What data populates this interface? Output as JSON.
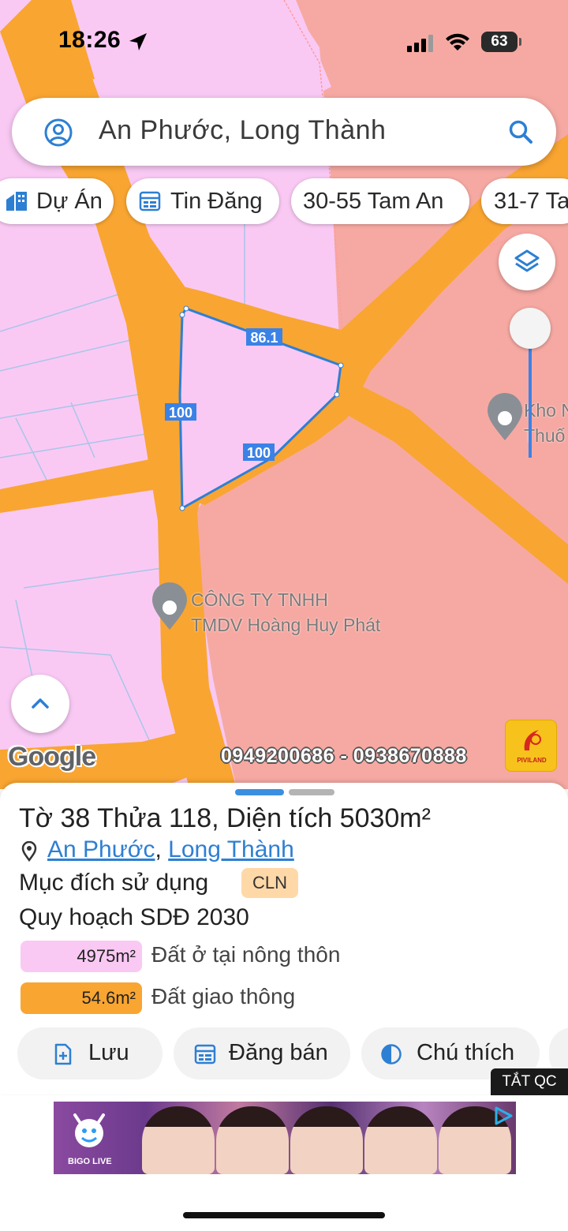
{
  "status_bar": {
    "time": "18:26",
    "battery": "63"
  },
  "search": {
    "query": "An Phước, Long Thành"
  },
  "chips": [
    {
      "label": "Dự Án",
      "icon": "building-icon"
    },
    {
      "label": "Tin Đăng",
      "icon": "listing-icon"
    },
    {
      "label": "30-55 Tam An",
      "icon": ""
    },
    {
      "label": "31-7 Ta",
      "icon": ""
    }
  ],
  "map": {
    "edge_labels": [
      "86.1",
      "100",
      "100"
    ],
    "poi_1": {
      "line1": "CÔNG TY TNHH",
      "line2": "TMDV Hoàng Huy Phát"
    },
    "poi_2": {
      "line1": "Kho N",
      "line2": "Thuố"
    },
    "google_logo": "Google",
    "phone_overlay": "0949200686 - 0938670888",
    "brand_badge": "PIVILAND",
    "colors": {
      "residential": "#f9c9f4",
      "rural": "#f6a9a2",
      "road": "#f9a531",
      "parcel_border": "#2f7fd4"
    }
  },
  "parcel": {
    "title": "Tờ 38 Thửa 118, Diện tích 5030m²",
    "location": {
      "commune": "An Phước",
      "separator": ",",
      "district": "Long Thành"
    },
    "purpose_label": "Mục đích sử dụng",
    "purpose_code": "CLN",
    "plan_label": "Quy hoạch SDĐ 2030",
    "zones": [
      {
        "area": "4975m²",
        "label": "Đất ở tại nông thôn",
        "color": "#f9c9f4"
      },
      {
        "area": "54.6m²",
        "label": "Đất giao thông",
        "color": "#f9a531"
      }
    ]
  },
  "actions": {
    "save": "Lưu",
    "post": "Đăng bán",
    "legend": "Chú thích"
  },
  "ad": {
    "close_label": "TẮT QC",
    "brand": "BIGO LIVE"
  }
}
